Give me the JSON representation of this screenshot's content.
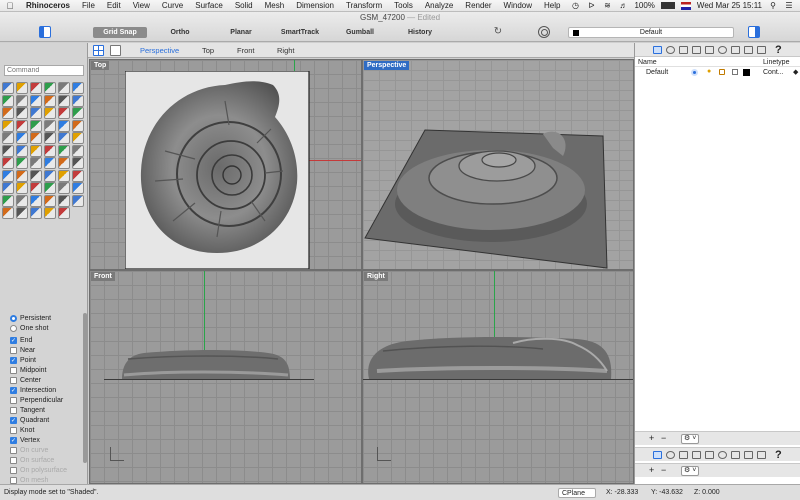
{
  "menubar": {
    "app_name": "Rhinoceros",
    "items": [
      "File",
      "Edit",
      "View",
      "Curve",
      "Surface",
      "Solid",
      "Mesh",
      "Dimension",
      "Transform",
      "Tools",
      "Analyze",
      "Render",
      "Window",
      "Help"
    ],
    "battery": "100%",
    "clock": "Wed Mar 25  15:11"
  },
  "window": {
    "title": "GSM_47200",
    "edited": "— Edited"
  },
  "toolbar": {
    "modes": [
      {
        "label": "Grid Snap",
        "active": true
      },
      {
        "label": "Ortho",
        "active": false
      },
      {
        "label": "Planar",
        "active": false
      },
      {
        "label": "SmartTrack",
        "active": false
      },
      {
        "label": "Gumball",
        "active": false
      },
      {
        "label": "History",
        "active": false
      }
    ],
    "current_layer": "Default"
  },
  "command": {
    "placeholder": "Command"
  },
  "osnap": {
    "mode_persistent": "Persistent",
    "mode_oneshot": "One shot",
    "items": [
      {
        "label": "End",
        "checked": true,
        "enabled": true
      },
      {
        "label": "Near",
        "checked": false,
        "enabled": true
      },
      {
        "label": "Point",
        "checked": true,
        "enabled": true
      },
      {
        "label": "Midpoint",
        "checked": false,
        "enabled": true
      },
      {
        "label": "Center",
        "checked": false,
        "enabled": true
      },
      {
        "label": "Intersection",
        "checked": true,
        "enabled": true
      },
      {
        "label": "Perpendicular",
        "checked": false,
        "enabled": true
      },
      {
        "label": "Tangent",
        "checked": false,
        "enabled": true
      },
      {
        "label": "Quadrant",
        "checked": true,
        "enabled": true
      },
      {
        "label": "Knot",
        "checked": false,
        "enabled": true
      },
      {
        "label": "Vertex",
        "checked": true,
        "enabled": true
      },
      {
        "label": "On curve",
        "checked": false,
        "enabled": false
      },
      {
        "label": "On surface",
        "checked": false,
        "enabled": false
      },
      {
        "label": "On polysurface",
        "checked": false,
        "enabled": false
      },
      {
        "label": "On mesh",
        "checked": false,
        "enabled": false
      }
    ]
  },
  "viewport_tabs": [
    "Perspective",
    "Top",
    "Front",
    "Right"
  ],
  "viewports": {
    "top": "Top",
    "perspective": "Perspective",
    "front": "Front",
    "right": "Right"
  },
  "layers_panel": {
    "col_name": "Name",
    "col_linetype": "Linetype",
    "row_name": "Default",
    "row_linetype": "Cont...",
    "help": "?"
  },
  "status": {
    "message": "Display mode set to \"Shaded\".",
    "cplane": "CPlane",
    "x": "X: -28.333",
    "y": "Y: -43.632",
    "z": "Z: 0.000"
  }
}
